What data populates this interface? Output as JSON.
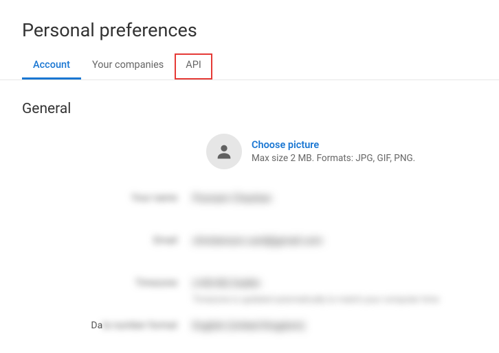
{
  "page": {
    "title": "Personal preferences"
  },
  "tabs": {
    "items": [
      {
        "label": "Account",
        "active": true
      },
      {
        "label": "Your companies",
        "active": false
      },
      {
        "label": "API",
        "active": false,
        "highlighted": true
      }
    ]
  },
  "section": {
    "title": "General"
  },
  "avatar": {
    "choose_label": "Choose picture",
    "hint": "Max size 2 MB. Formats: JPG, GIF, PNG."
  },
  "fields": {
    "name": {
      "label": "Your name",
      "value": "Poonam Chauhan"
    },
    "email": {
      "label": "Email",
      "value": "christenson.card@gmail.com"
    },
    "timezone": {
      "label": "Timezone",
      "value": "(+00:00) Dublin",
      "sub": "Timezone is updated automatically to match your computer time"
    },
    "date_format": {
      "label_visible_prefix": "Da",
      "label_blurred_rest": "te number format",
      "value": "English (United Kingdom)"
    }
  }
}
